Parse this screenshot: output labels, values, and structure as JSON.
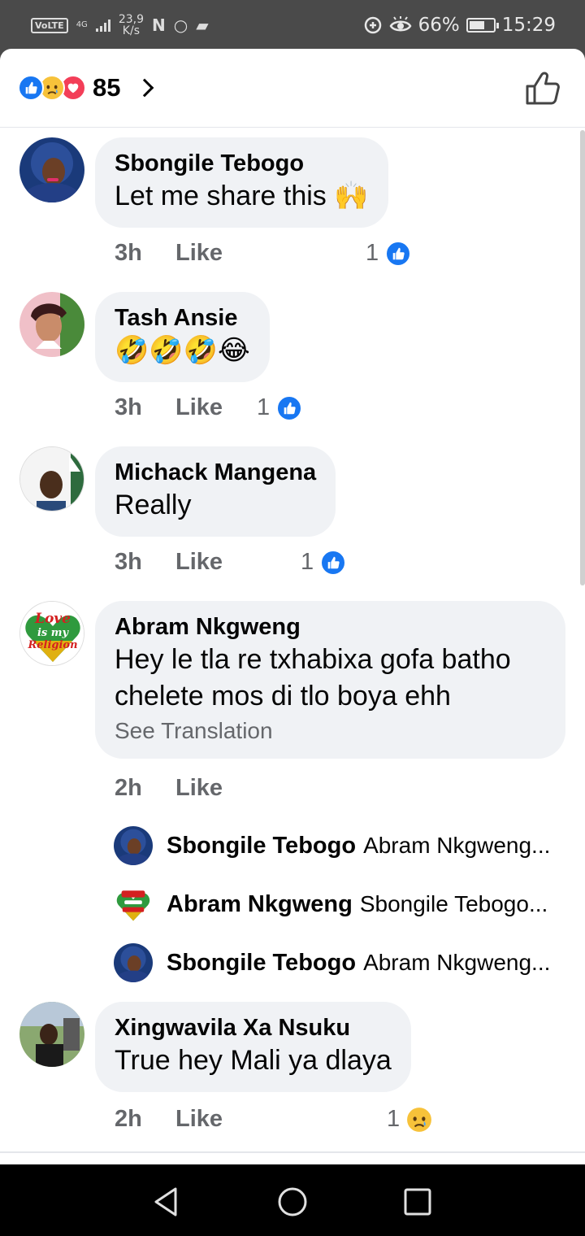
{
  "status_bar": {
    "volte": "VoLTE",
    "network": "4G",
    "speed_value": "23,9",
    "speed_unit": "K/s",
    "notif_icons": "N",
    "battery": "66%",
    "battery_level": 0.66,
    "time": "15:29"
  },
  "header": {
    "reaction_icons": [
      "like-icon",
      "sad-icon",
      "love-icon"
    ],
    "reaction_count": "85"
  },
  "comments": [
    {
      "name": "Sbongile Tebogo",
      "text": "Let me share this 🙌",
      "time": "3h",
      "like_label": "Like",
      "reaction_count": "1",
      "reaction": "like"
    },
    {
      "name": "Tash Ansie",
      "text": "🤣🤣🤣😂",
      "time": "3h",
      "like_label": "Like",
      "reaction_count": "1",
      "reaction": "like"
    },
    {
      "name": "Michack Mangena",
      "text": "Really",
      "time": "3h",
      "like_label": "Like",
      "reaction_count": "1",
      "reaction": "like"
    },
    {
      "name": "Abram Nkgweng",
      "text_line1": "Hey le tla re txhabixa gofa batho",
      "text_line2": "chelete mos di tlo boya ehh",
      "translation": "See Translation",
      "time": "2h",
      "like_label": "Like"
    },
    {
      "name": "Xingwavila Xa Nsuku",
      "text": "True hey Mali ya dlaya",
      "time": "2h",
      "like_label": "Like",
      "reaction_count": "1",
      "reaction": "sad"
    }
  ],
  "replies": [
    {
      "name": "Sbongile Tebogo",
      "text": "Abram Nkgweng..."
    },
    {
      "name": "Abram Nkgweng",
      "text": "Sbongile Tebogo..."
    },
    {
      "name": "Sbongile Tebogo",
      "text": "Abram Nkgweng..."
    }
  ],
  "avatar_badge": {
    "line1": "Love",
    "line2": "is my",
    "line3": "Religion"
  },
  "colors": {
    "facebook_blue": "#1877f2",
    "bubble_grey": "#f0f2f5",
    "meta_grey": "#65676b",
    "love_red": "#f33e58",
    "sad_yellow": "#f7c23a"
  }
}
